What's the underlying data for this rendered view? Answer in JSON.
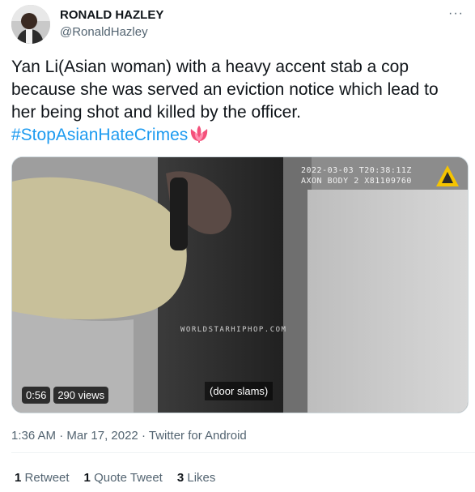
{
  "author": {
    "name": "RONALD HAZLEY",
    "handle": "@RonaldHazley"
  },
  "more_label": "···",
  "tweet": {
    "text": "Yan Li(Asian woman) with a heavy accent stab a cop because she was served an eviction notice which lead to her being shot and killed by the officer.",
    "hashtag": "#StopAsianHateCrimes",
    "emoji_icon": "tulip-icon"
  },
  "media": {
    "bodycam_line1": "2022-03-03 T20:38:11Z",
    "bodycam_line2": "AXON BODY 2 X81109760",
    "watermark": "WORLDSTARHIPHOP.COM",
    "caption": "(door slams)",
    "duration": "0:56",
    "views": "290 views"
  },
  "meta": {
    "time": "1:36 AM",
    "separator": "·",
    "date": "Mar 17, 2022",
    "source": "Twitter for Android"
  },
  "stats": {
    "retweets_count": "1",
    "retweets_label": "Retweet",
    "quotes_count": "1",
    "quotes_label": "Quote Tweet",
    "likes_count": "3",
    "likes_label": "Likes"
  },
  "colors": {
    "link": "#1d9bf0",
    "secondary_text": "#536471",
    "primary_text": "#0f1419"
  }
}
